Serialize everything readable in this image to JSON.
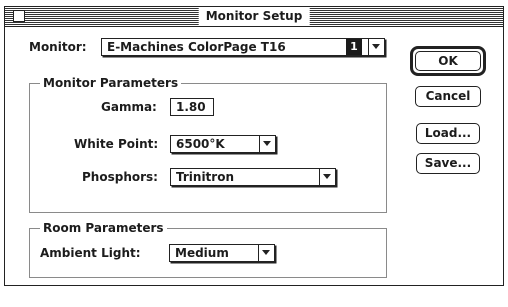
{
  "window": {
    "title": "Monitor Setup"
  },
  "monitor": {
    "label": "Monitor:",
    "value": "E-Machines ColorPage T16",
    "number": "1"
  },
  "monitor_parameters": {
    "title": "Monitor Parameters",
    "gamma_label": "Gamma:",
    "gamma_value": "1.80",
    "white_point_label": "White Point:",
    "white_point_value": "6500°K",
    "phosphors_label": "Phosphors:",
    "phosphors_value": "Trinitron"
  },
  "room_parameters": {
    "title": "Room Parameters",
    "ambient_light_label": "Ambient Light:",
    "ambient_light_value": "Medium"
  },
  "buttons": {
    "ok": "OK",
    "cancel": "Cancel",
    "load": "Load...",
    "save": "Save..."
  }
}
